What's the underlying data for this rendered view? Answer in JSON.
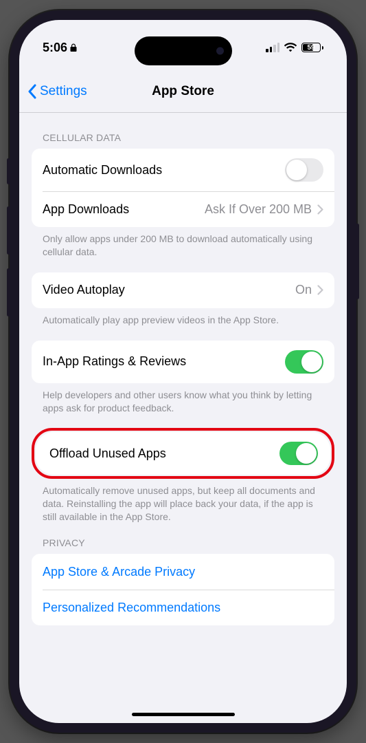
{
  "status": {
    "time": "5:06",
    "battery": "59"
  },
  "nav": {
    "back": "Settings",
    "title": "App Store"
  },
  "sections": {
    "cellular": {
      "header": "Cellular Data",
      "auto_downloads": {
        "label": "Automatic Downloads",
        "on": false
      },
      "app_downloads": {
        "label": "App Downloads",
        "value": "Ask If Over 200 MB"
      },
      "footer": "Only allow apps under 200 MB to download automatically using cellular data."
    },
    "video": {
      "label": "Video Autoplay",
      "value": "On",
      "footer": "Automatically play app preview videos in the App Store."
    },
    "ratings": {
      "label": "In-App Ratings & Reviews",
      "on": true,
      "footer": "Help developers and other users know what you think by letting apps ask for product feedback."
    },
    "offload": {
      "label": "Offload Unused Apps",
      "on": true,
      "footer": "Automatically remove unused apps, but keep all documents and data. Reinstalling the app will place back your data, if the app is still available in the App Store."
    },
    "privacy": {
      "header": "Privacy",
      "items": [
        "App Store & Arcade Privacy",
        "Personalized Recommendations"
      ]
    }
  }
}
